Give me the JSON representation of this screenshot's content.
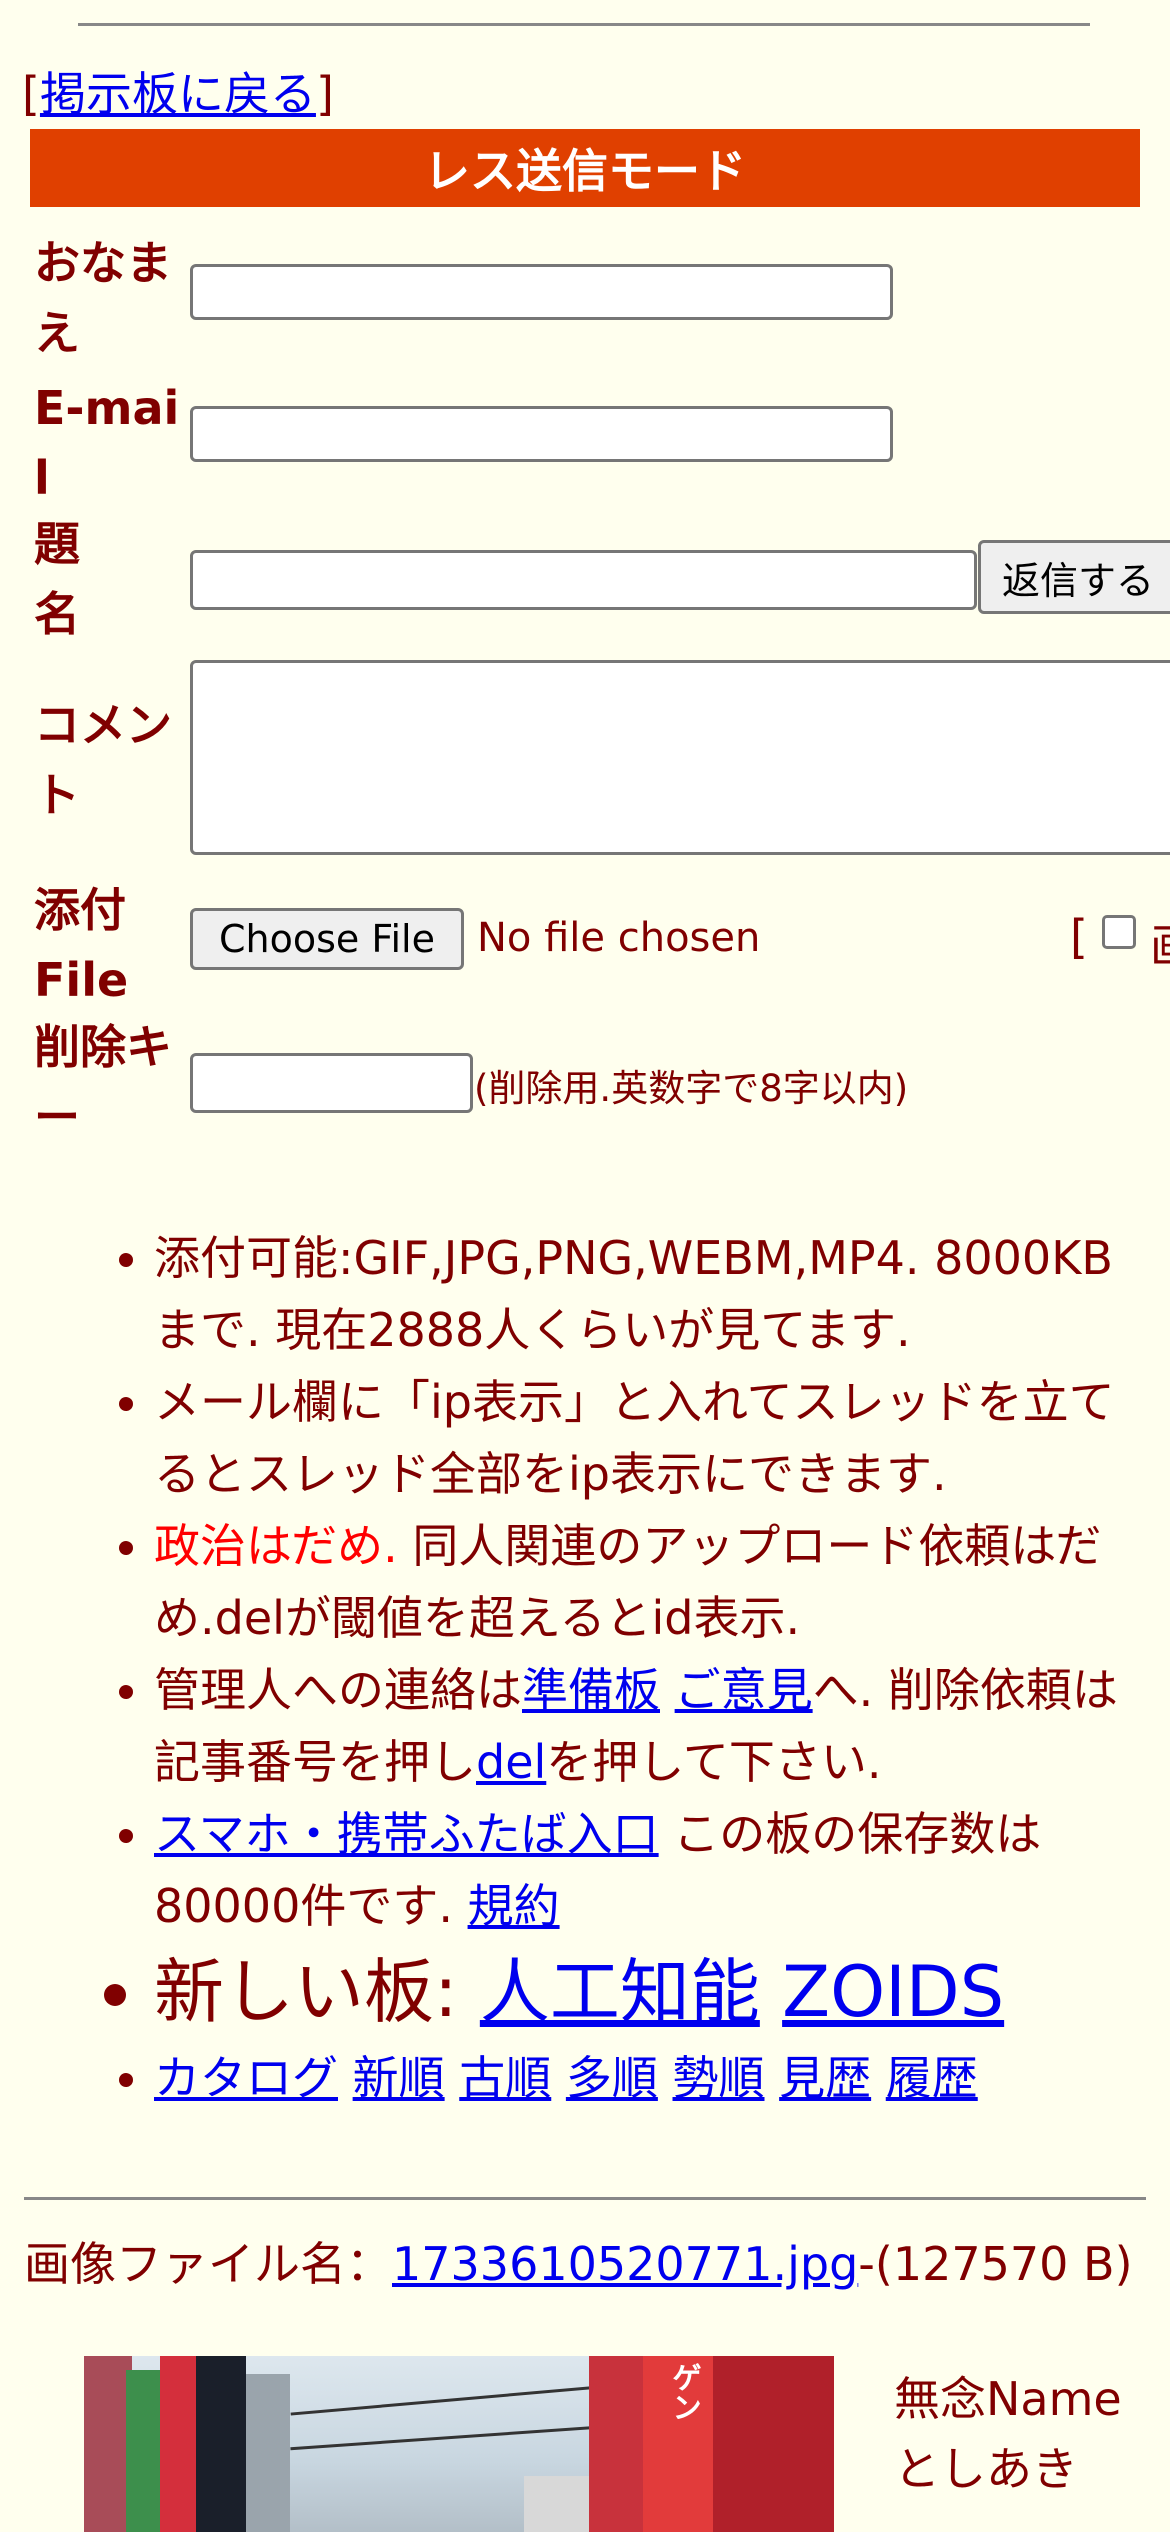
{
  "nav": {
    "bracket_open": "[",
    "back_label": "掲示板に戻る",
    "bracket_close": "]"
  },
  "form": {
    "mode_title": "レス送信モード",
    "name_label": "おなまえ",
    "email_label": "E-mail",
    "subject_label": "題名",
    "submit_label": "返信する",
    "comment_label": "コメント",
    "attach_label": "添付File",
    "choose_file_label": "Choose File",
    "no_file_text": "No file chosen",
    "attach_option_bracket": "[",
    "attach_option_label_partial": "画",
    "delkey_label": "削除キー",
    "delkey_note": "(削除用.英数字で8字以内)"
  },
  "notes": {
    "n1": "添付可能:GIF,JPG,PNG,WEBM,MP4. 8000KBまで. 現在2888人くらいが見てます.",
    "n2": "メール欄に「ip表示」と入れてスレッドを立てるとスレッド全部をip表示にできます.",
    "n3_red": "政治はだめ.",
    "n3_rest": " 同人関連のアップロード依頼はだめ.delが閾値を超えるとid表示.",
    "n4_a": "管理人への連絡は",
    "n4_link1": "準備板",
    "n4_link2": "ご意見",
    "n4_b": "へ. 削除依頼は記事番号を押し",
    "n4_link3": "del",
    "n4_c": "を押して下さい.",
    "n5_link": "スマホ・携帯ふたば入口",
    "n5_text": " この板の保存数は80000件です. ",
    "n5_terms": "規約",
    "new_boards_label": "新しい板: ",
    "new_board_1": "人工知能",
    "new_board_2": "ZOIDS",
    "sort_links": [
      "カタログ",
      "新順",
      "古順",
      "多順",
      "勢順",
      "見歴",
      "履歴"
    ]
  },
  "post": {
    "file_prefix": "画像ファイル名：",
    "file_name": "1733610520771.jpg",
    "file_size": "-(127570 B)",
    "thumbnail_sign_text": "ゲン",
    "name_line1": "無念Name",
    "name_line2": "としあき"
  },
  "colors": {
    "background": "#ffffee",
    "text": "#800000",
    "mode_bar": "#e04000",
    "link": "#0000ee",
    "warning": "#ff0000"
  }
}
